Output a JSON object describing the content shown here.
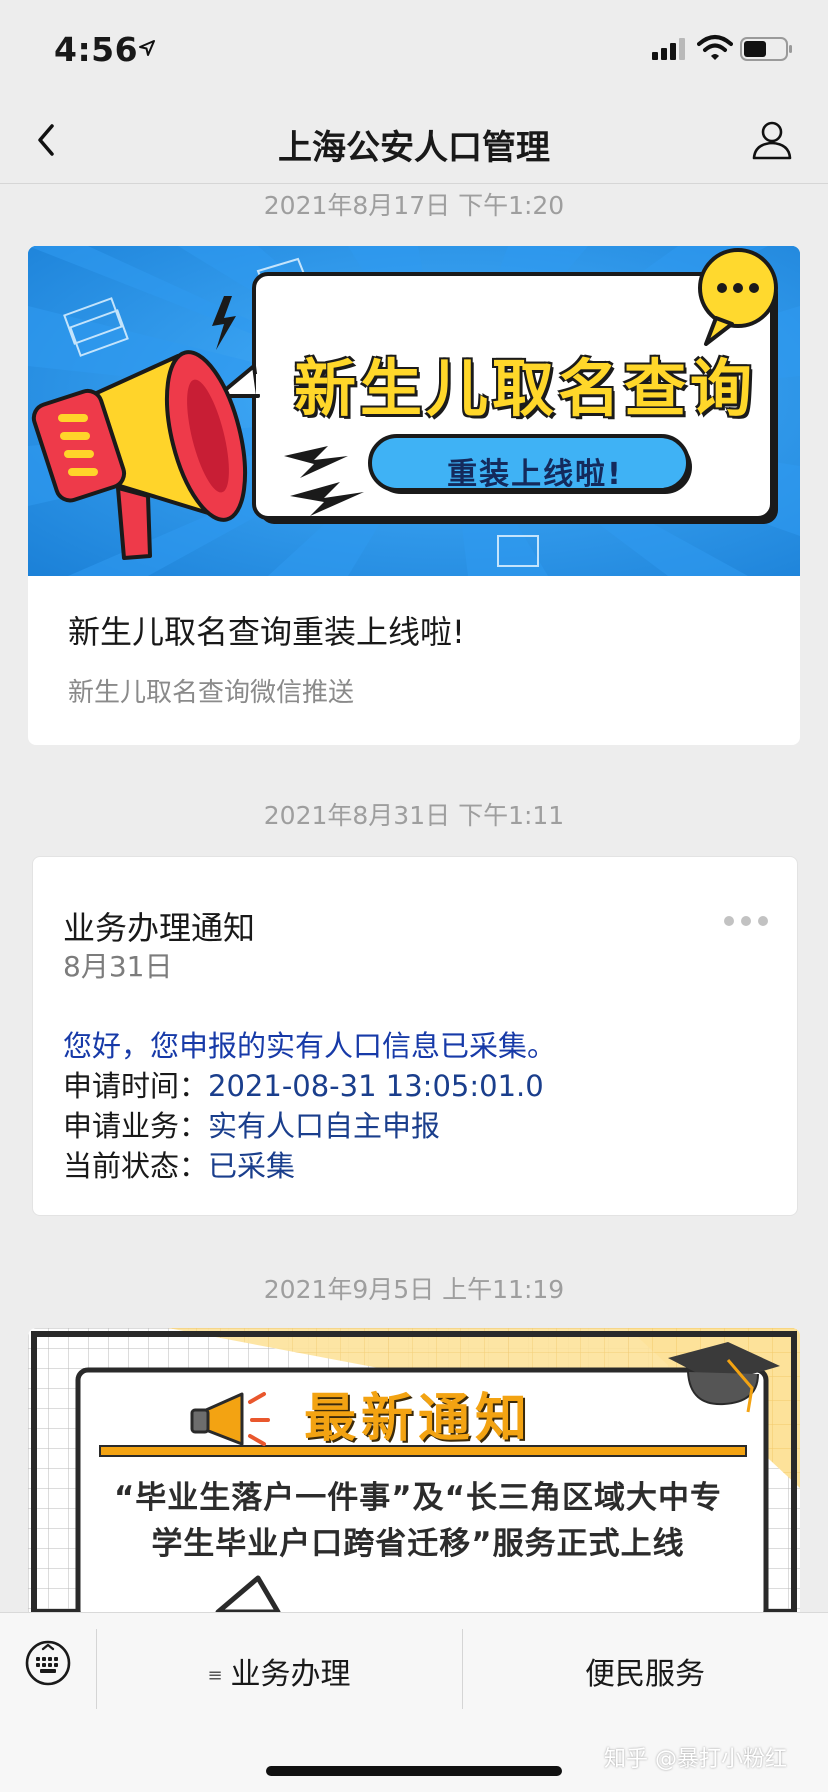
{
  "status_bar": {
    "time": "4:56"
  },
  "nav": {
    "title": "上海公安人口管理"
  },
  "timestamps": [
    "2021年8月17日 下午1:20",
    "2021年8月31日 下午1:11",
    "2021年9月5日 上午11:19"
  ],
  "article_1": {
    "banner_title": "新生儿取名查询",
    "banner_pill": "重装上线啦!",
    "headline": "新生儿取名查询重装上线啦!",
    "subtitle": "新生儿取名查询微信推送"
  },
  "notice": {
    "title": "业务办理通知",
    "date": "8月31日",
    "greeting": "您好，您申报的实有人口信息已采集。",
    "rows": [
      {
        "label": "申请时间：",
        "value": "2021-08-31 13:05:01.0"
      },
      {
        "label": "申请业务：",
        "value": "实有人口自主申报"
      },
      {
        "label": "当前状态：",
        "value": "已采集"
      }
    ]
  },
  "article_2": {
    "banner_title": "最新通知",
    "line_1": "“毕业生落户一件事”及“长三角区域大中专",
    "line_2": "学生毕业户口跨省迁移”服务正式上线"
  },
  "bottom_menu": {
    "item_1": "业务办理",
    "item_1_icon": "≡",
    "item_2": "便民服务"
  },
  "watermark": "知乎 @暴打小粉红",
  "colors": {
    "background": "#ededed",
    "link_blue": "#1a3e8c",
    "banner_blue": "#2797ea",
    "accent_yellow": "#ffd72a"
  }
}
